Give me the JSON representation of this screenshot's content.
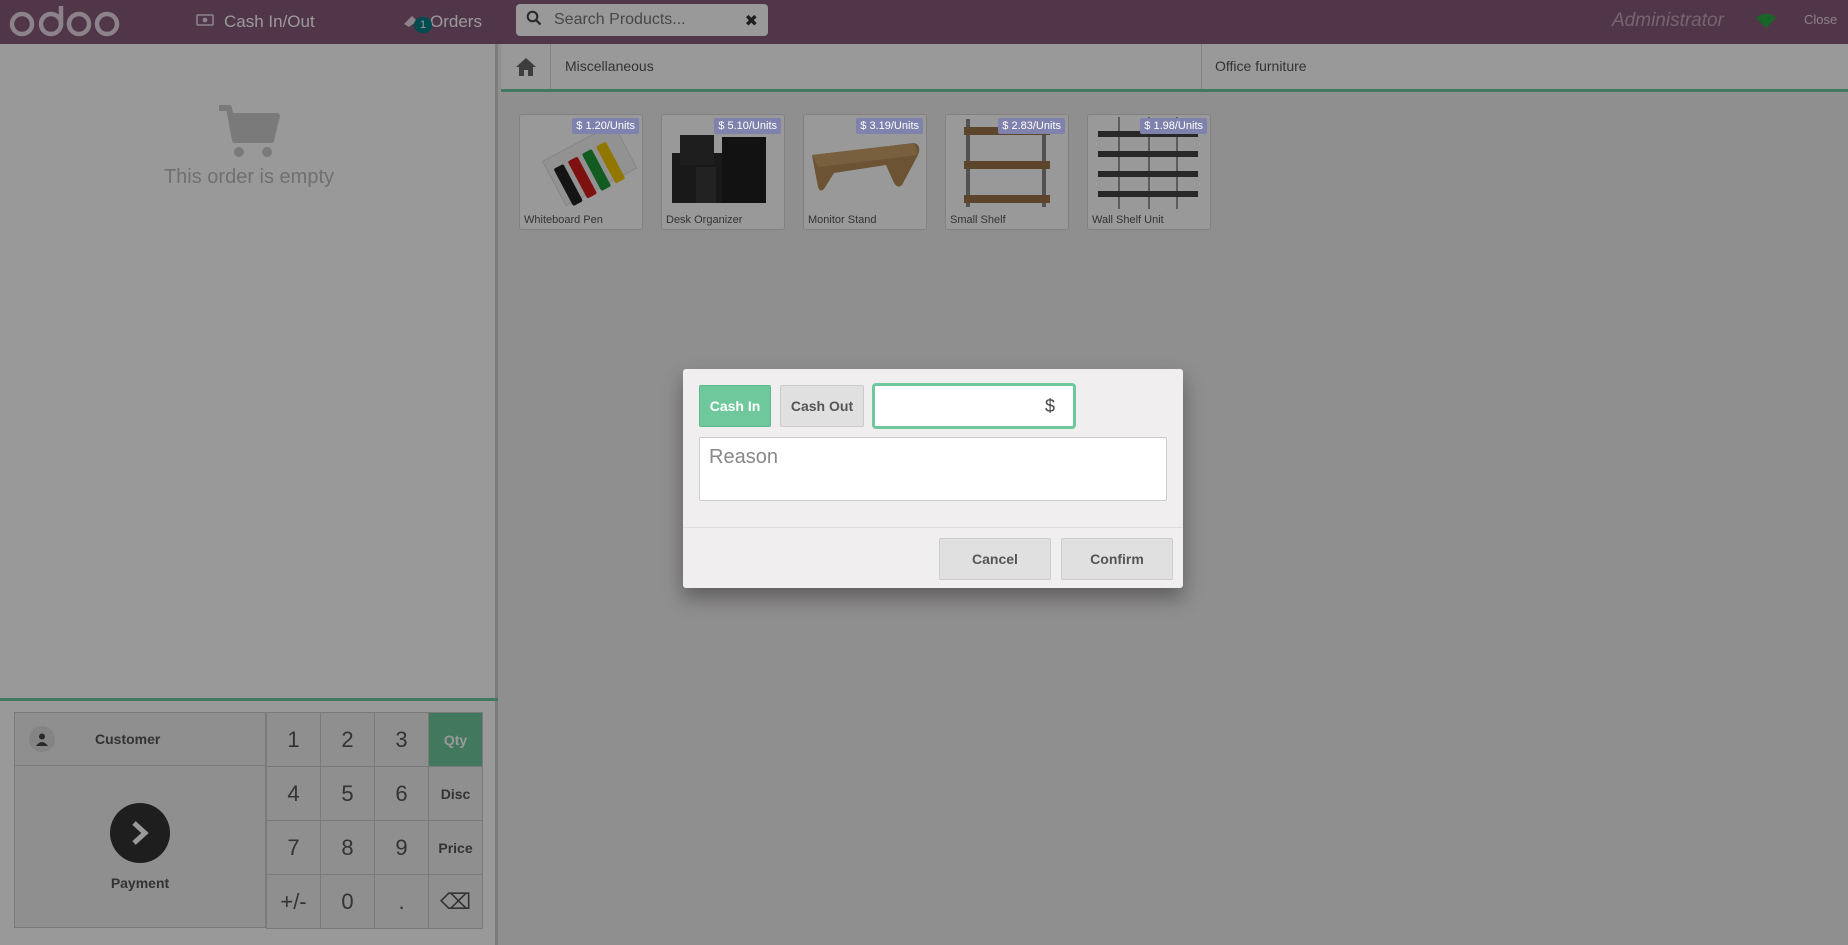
{
  "header": {
    "cash_in_out_label": "Cash In/Out",
    "orders_label": "Orders",
    "orders_badge": "1",
    "search_placeholder": "Search Products...",
    "user": "Administrator",
    "close_label": "Close",
    "bg_color": "#875a7b"
  },
  "order": {
    "empty_text": "This order is empty"
  },
  "control": {
    "customer_label": "Customer",
    "payment_label": "Payment"
  },
  "numpad": {
    "keys": [
      "1",
      "2",
      "3",
      "Qty",
      "4",
      "5",
      "6",
      "Disc",
      "7",
      "8",
      "9",
      "Price",
      "+/-",
      "0",
      ".",
      "⌫"
    ],
    "active_mode": "Qty"
  },
  "categories": [
    "Miscellaneous",
    "Office furniture"
  ],
  "products": [
    {
      "name": "Whiteboard Pen",
      "price": "$ 1.20/Units"
    },
    {
      "name": "Desk Organizer",
      "price": "$ 5.10/Units"
    },
    {
      "name": "Monitor Stand",
      "price": "$ 3.19/Units"
    },
    {
      "name": "Small Shelf",
      "price": "$ 2.83/Units"
    },
    {
      "name": "Wall Shelf Unit",
      "price": "$ 1.98/Units"
    }
  ],
  "modal": {
    "cash_in_label": "Cash In",
    "cash_out_label": "Cash Out",
    "amount_value": "",
    "currency": "$",
    "reason_placeholder": "Reason",
    "cancel_label": "Cancel",
    "confirm_label": "Confirm"
  },
  "colors": {
    "accent": "#6ec89b",
    "brand": "#875a7b"
  }
}
